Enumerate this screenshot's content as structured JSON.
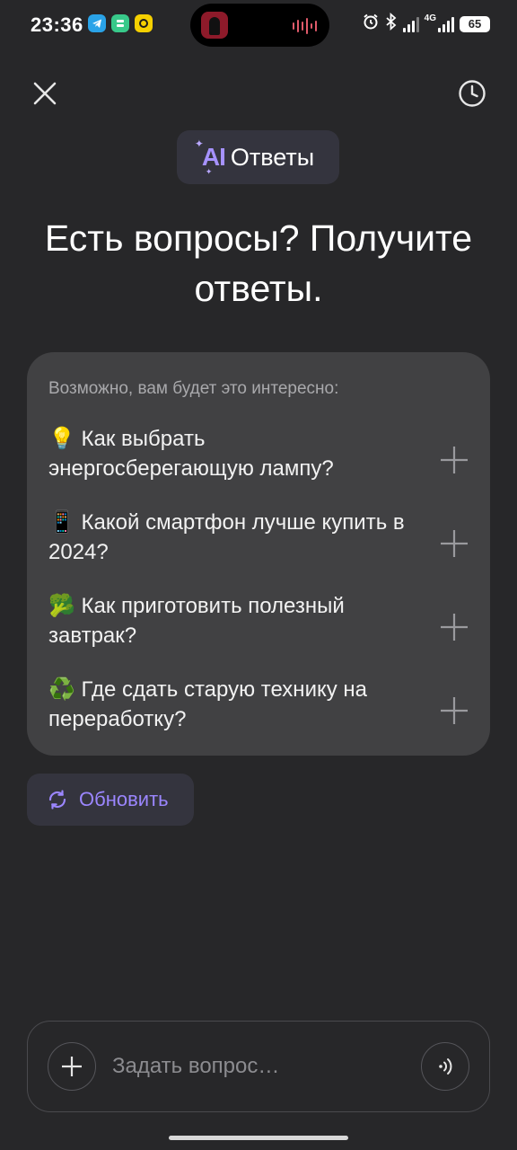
{
  "status_bar": {
    "time": "23:36",
    "network": "4G",
    "battery": "65"
  },
  "header": {
    "badge_mark": "AI",
    "badge_label": "Ответы"
  },
  "heading": "Есть вопросы? Получите ответы.",
  "suggestions": {
    "caption": "Возможно, вам будет это интересно:",
    "items": [
      {
        "text": "💡 Как выбрать энергосберегающую лампу?"
      },
      {
        "text": "📱 Какой смартфон лучше купить в 2024?"
      },
      {
        "text": "🥦 Как приготовить полезный завтрак?"
      },
      {
        "text": "♻️ Где сдать старую технику на переработку?"
      }
    ]
  },
  "refresh": {
    "label": "Обновить"
  },
  "composer": {
    "placeholder": "Задать вопрос…"
  },
  "colors": {
    "background": "#272729",
    "card": "#414143",
    "accent": "#9b86ff",
    "chip": "#34343e"
  }
}
